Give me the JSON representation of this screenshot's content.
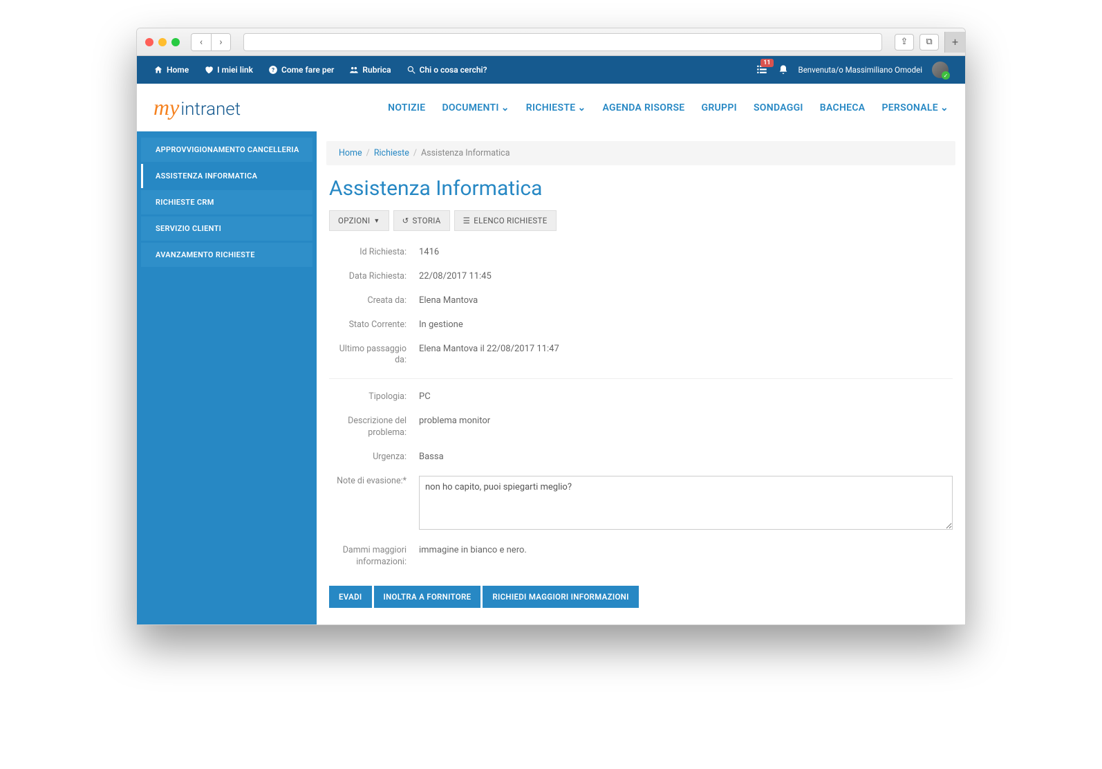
{
  "topbar": {
    "home": "Home",
    "links": "I miei link",
    "howto": "Come fare per",
    "rubrica": "Rubrica",
    "search_placeholder": "Chi o cosa cerchi?",
    "badge_count": "11",
    "welcome": "Benvenuta/o Massimiliano Omodei"
  },
  "logo": {
    "my": "my",
    "rest": "intranet"
  },
  "nav": {
    "notizie": "NOTIZIE",
    "documenti": "DOCUMENTI",
    "richieste": "RICHIESTE",
    "agenda": "AGENDA RISORSE",
    "gruppi": "GRUPPI",
    "sondaggi": "SONDAGGI",
    "bacheca": "BACHECA",
    "personale": "PERSONALE"
  },
  "sidebar": {
    "items": [
      "APPROVVIGIONAMENTO CANCELLERIA",
      "ASSISTENZA INFORMATICA",
      "RICHIESTE CRM",
      "SERVIZIO CLIENTI",
      "AVANZAMENTO RICHIESTE"
    ]
  },
  "breadcrumb": {
    "home": "Home",
    "richieste": "Richieste",
    "current": "Assistenza Informatica"
  },
  "page": {
    "title": "Assistenza Informatica"
  },
  "toolbar": {
    "opzioni": "OPZIONI",
    "storia": "STORIA",
    "elenco": "ELENCO RICHIESTE"
  },
  "fields": {
    "id_label": "Id Richiesta:",
    "id_value": "1416",
    "data_label": "Data Richiesta:",
    "data_value": "22/08/2017 11:45",
    "creata_label": "Creata da:",
    "creata_value": "Elena Mantova",
    "stato_label": "Stato Corrente:",
    "stato_value": "In gestione",
    "passaggio_label": "Ultimo passaggio da:",
    "passaggio_value": "Elena Mantova il 22/08/2017 11:47",
    "tipologia_label": "Tipologia:",
    "tipologia_value": "PC",
    "descrizione_label": "Descrizione del problema:",
    "descrizione_value": "problema monitor",
    "urgenza_label": "Urgenza:",
    "urgenza_value": "Bassa",
    "note_label": "Note di evasione:*",
    "note_value": "non ho capito, puoi spiegarti meglio?",
    "info_label": "Dammi maggiori informazioni:",
    "info_value": "immagine in bianco e nero."
  },
  "actions": {
    "evadi": "EVADI",
    "inoltra": "INOLTRA A FORNITORE",
    "richiedi": "RICHIEDI MAGGIORI INFORMAZIONI"
  }
}
